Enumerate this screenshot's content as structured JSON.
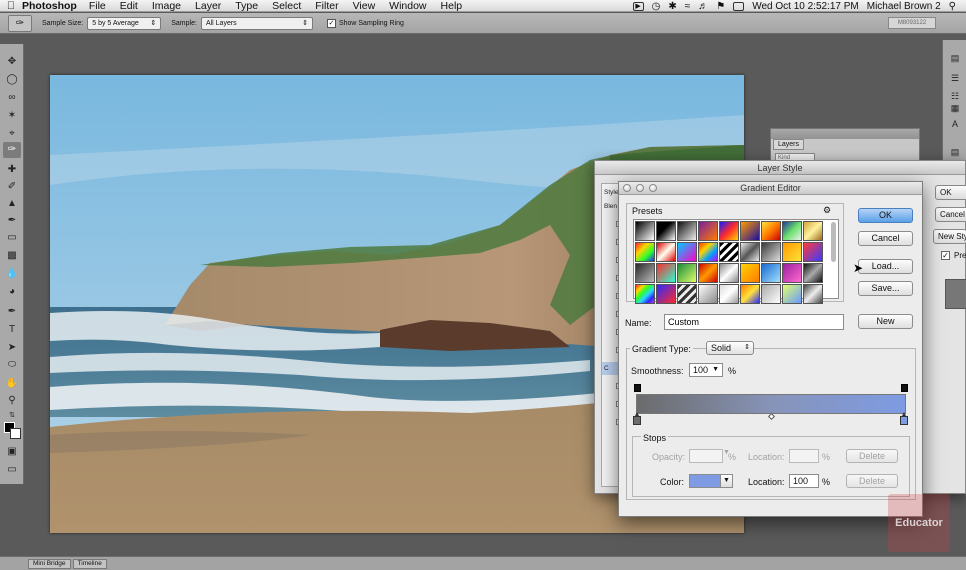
{
  "menubar": {
    "app_name": "Photoshop",
    "items": [
      "File",
      "Edit",
      "Image",
      "Layer",
      "Type",
      "Select",
      "Filter",
      "View",
      "Window",
      "Help"
    ],
    "clock": "Wed Oct 10  2:52:17 PM",
    "user": "Michael Brown 2"
  },
  "options_bar": {
    "sample_size_label": "Sample Size:",
    "sample_size_value": "5 by 5 Average",
    "sample_label": "Sample:",
    "sample_value": "All Layers",
    "show_ring_label": "Show Sampling Ring",
    "show_ring_checked": true,
    "right_field": "M8093122"
  },
  "layers_panel": {
    "tab": "Layers",
    "kind_placeholder": "Kind"
  },
  "layer_style": {
    "title": "Layer Style",
    "list_items": [
      "Style",
      "Blen",
      "",
      "",
      "",
      "",
      "",
      "",
      "",
      "",
      "C",
      "",
      "",
      ""
    ],
    "ok_label": "OK",
    "cancel_label": "Cancel",
    "new_style_label": "New Style...",
    "preview_label": "Preview",
    "preview_checked": true
  },
  "gradient_editor": {
    "title": "Gradient Editor",
    "presets_label": "Presets",
    "ok_label": "OK",
    "cancel_label": "Cancel",
    "load_label": "Load...",
    "save_label": "Save...",
    "name_label": "Name:",
    "name_value": "Custom",
    "new_label": "New",
    "gradient_type_label": "Gradient Type:",
    "gradient_type_value": "Solid",
    "smoothness_label": "Smoothness:",
    "smoothness_value": "100",
    "percent": "%",
    "stops_label": "Stops",
    "opacity_label": "Opacity:",
    "location_label": "Location:",
    "delete_label": "Delete",
    "color_label": "Color:",
    "color_location_value": "100",
    "gradient_colors": [
      "#6b6b6b",
      "#8794b8",
      "#7e9be3"
    ],
    "stop_color": "#7e9be3",
    "preset_swatches": [
      "linear-gradient(135deg,#000,#fff)",
      "linear-gradient(135deg,#000,#000 40%,transparent)",
      "linear-gradient(135deg,#111,#eee)",
      "linear-gradient(135deg,#7a1fa0,#ff7a00)",
      "linear-gradient(135deg,#1a1aff,#ff2a2a,#ffd400)",
      "linear-gradient(135deg,#ff9a00,#1a0fa0)",
      "linear-gradient(135deg,#ffe23a,#ff7a00,#c00)",
      "linear-gradient(135deg,#1f3a9a,#6be06b,#eee)",
      "linear-gradient(135deg,#d7a43a,#fff2a0,#9a6a1a)",
      "linear-gradient(135deg,#ff2a2a,#ffd400,#2aff2a,#2a2aff)",
      "linear-gradient(135deg,#d00,#ffe,#d00)",
      "linear-gradient(135deg,#00c8ff,#ff00c8)",
      "linear-gradient(135deg,#ff3a00,#ffd400,#00a0ff,#c800ff)",
      "repeating-linear-gradient(135deg,#000 0 3px,#fff 3px 6px)",
      "linear-gradient(135deg,#eee,#555,#eee)",
      "linear-gradient(135deg,#3a3a3a,#ddd)",
      "linear-gradient(135deg,#ff9a00,#ffe23a)",
      "linear-gradient(135deg,#ff3a3a,#3a3aff)",
      "linear-gradient(135deg,#2a2a2a,#bbb)",
      "linear-gradient(135deg,#ff2a2a,#2affd4)",
      "linear-gradient(135deg,#1a8a3a,#e0ff6b)",
      "linear-gradient(135deg,#c00,#ff9a00,#c00)",
      "linear-gradient(135deg,#888,#fff,#888)",
      "linear-gradient(135deg,#ffd400,#ff7a00)",
      "linear-gradient(135deg,#1a6ad0,#a0e0ff)",
      "linear-gradient(135deg,#9a1fa0,#ff6bd0)",
      "linear-gradient(135deg,#111,#aaa,#111)",
      "linear-gradient(135deg,#ff2a2a,#ffd400,#2aff2a,#2ad4ff,#2a2aff,#c82aff)",
      "linear-gradient(135deg,#2a2aff,#ff2a2a)",
      "repeating-linear-gradient(135deg,#333 0 3px,#eee 3px 6px)",
      "linear-gradient(135deg,#fff,#888)",
      "linear-gradient(135deg,#ddd,#fff,#999)",
      "linear-gradient(135deg,#ff7a00,#ffe23a,#2a2aff)",
      "linear-gradient(135deg,#aaa,#fff)",
      "linear-gradient(135deg,#e0ff6b,#6b9aff)",
      "linear-gradient(135deg,#444,#eee,#444)"
    ]
  }
}
